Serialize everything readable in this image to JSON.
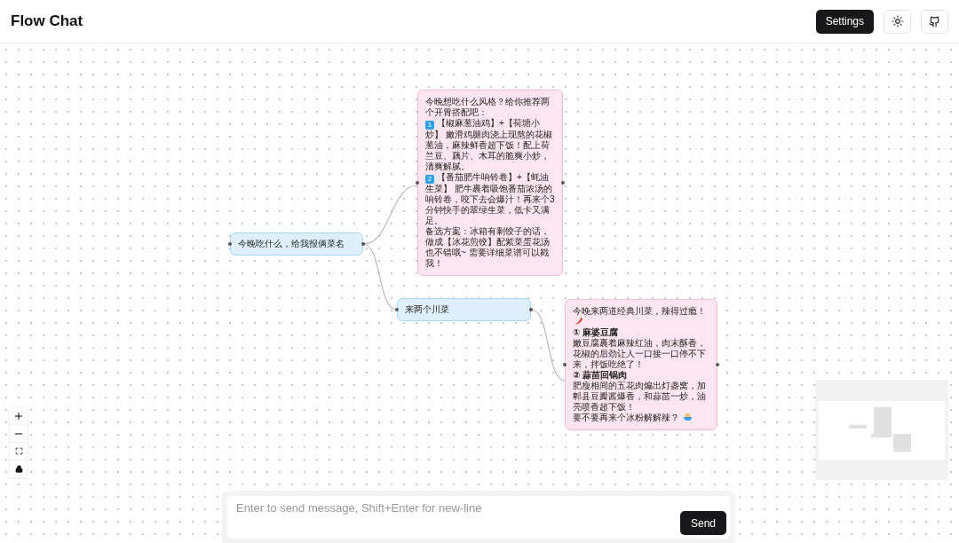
{
  "header": {
    "title": "Flow Chat",
    "settings_button": "Settings"
  },
  "nodes": [
    {
      "kind": "user",
      "lines": [
        {
          "kind": "text",
          "text": "今晚吃什么，给我报俩菜名"
        }
      ]
    },
    {
      "kind": "assistant",
      "lines": [
        {
          "kind": "text",
          "text": "今晚想吃什么风格？给你推荐两个开胃搭配吧："
        },
        {
          "kind": "badge",
          "badge": "1",
          "text": "【椒麻葱油鸡】+【荷塘小炒】 嫩滑鸡腿肉浇上现熬的花椒葱油，麻辣鲜香超下饭！配上荷兰豆、藕片、木耳的脆爽小炒，清爽解腻。"
        },
        {
          "kind": "badge",
          "badge": "2",
          "text": "【番茄肥牛响铃卷】+【蚝油生菜】 肥牛裹着吸饱番茄浓汤的响铃卷，咬下去会爆汁！再来个3分钟快手的翠绿生菜，低卡又满足。"
        },
        {
          "kind": "text",
          "text": "备选方案：冰箱有剩饺子的话，做成【冰花煎饺】配紫菜蛋花汤也不错哦~ 需要详细菜谱可以戳我！"
        }
      ]
    },
    {
      "kind": "user",
      "lines": [
        {
          "kind": "text",
          "text": "来两个川菜"
        }
      ]
    },
    {
      "kind": "assistant",
      "lines": [
        {
          "kind": "chili",
          "text": "今晚来两道经典川菜，辣得过瘾！"
        },
        {
          "kind": "heading",
          "text": "① 麻婆豆腐"
        },
        {
          "kind": "text",
          "text": "嫩豆腐裹着麻辣红油，肉末酥香，花椒的后劲让人一口接一口停不下来，拌饭吃绝了！"
        },
        {
          "kind": "heading",
          "text": "② 蒜苗回锅肉"
        },
        {
          "kind": "text",
          "text": "肥瘦相间的五花肉煸出灯盏窝，加郫县豆瓣酱爆香，和蒜苗一炒，油亮喷香超下饭！"
        },
        {
          "kind": "bowl",
          "text": "要不要再来个冰粉解解辣？"
        }
      ]
    }
  ],
  "composer": {
    "placeholder": "Enter to send message, Shift+Enter for new-line",
    "send_button": "Send"
  }
}
